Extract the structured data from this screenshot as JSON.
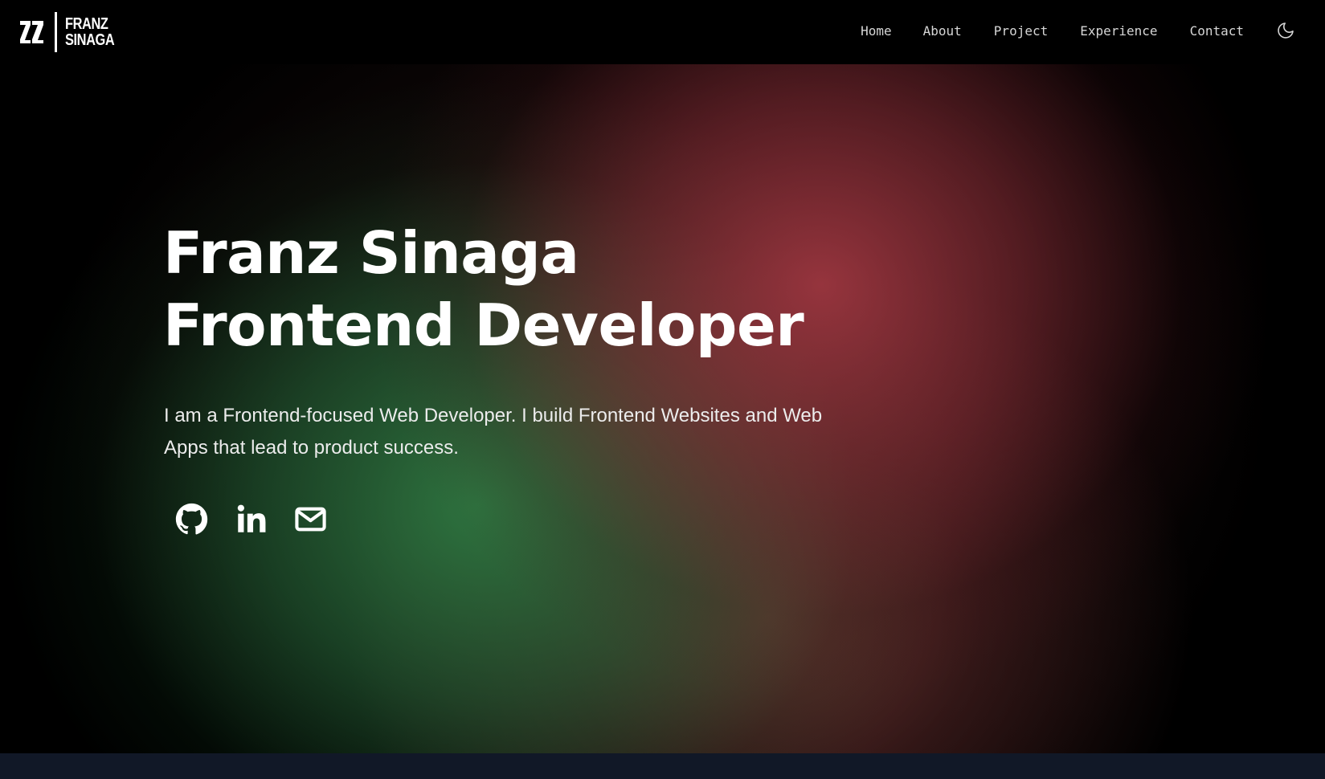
{
  "logo": {
    "line1": "FRANZ",
    "line2": "SINAGA",
    "icon": "zz-monogram-icon"
  },
  "nav": {
    "items": [
      {
        "label": "Home"
      },
      {
        "label": "About"
      },
      {
        "label": "Project"
      },
      {
        "label": "Experience"
      },
      {
        "label": "Contact"
      }
    ],
    "theme_toggle_icon": "moon-icon"
  },
  "hero": {
    "title_line1": "Franz Sinaga",
    "title_line2": "Frontend Developer",
    "description": "I am a Frontend-focused Web Developer. I build Frontend Websites and Web Apps that lead to product success.",
    "socials": [
      {
        "icon": "github-icon"
      },
      {
        "icon": "linkedin-icon"
      },
      {
        "icon": "mail-icon"
      }
    ]
  },
  "colors": {
    "background": "#000000",
    "nav_text": "#d6d6d6",
    "glow_red": "#a03741",
    "glow_green": "#2d7841",
    "bottom_strip": "#111827"
  }
}
